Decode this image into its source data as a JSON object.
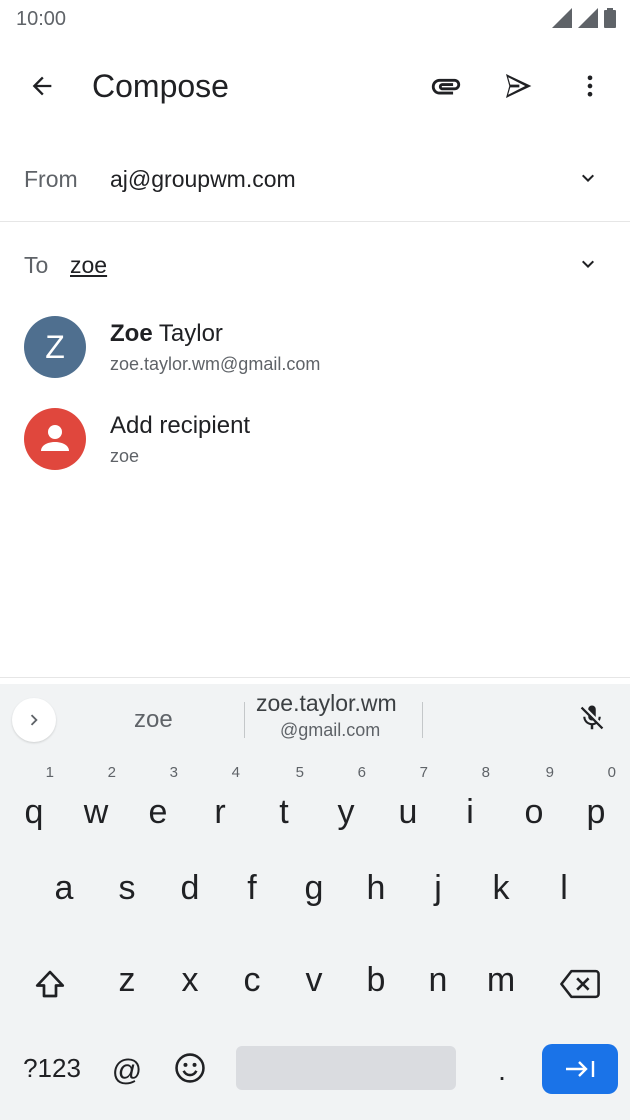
{
  "status_bar": {
    "time": "10:00"
  },
  "app_bar": {
    "title": "Compose"
  },
  "from": {
    "label": "From",
    "value": "aj@groupwm.com"
  },
  "to": {
    "label": "To",
    "value": "zoe"
  },
  "suggestions": [
    {
      "avatar_letter": "Z",
      "name_bold": "Zoe",
      "name_rest": " Taylor",
      "sub": "zoe.taylor.wm@gmail.com",
      "avatar_color": "#4f6f8f"
    },
    {
      "avatar_letter": "",
      "name_bold": "",
      "name_rest": "Add recipient",
      "sub": "zoe",
      "avatar_color": "#e0473d"
    }
  ],
  "keyboard_suggestions": {
    "word": "zoe",
    "email_line1": "zoe.taylor.wm",
    "email_line2": "@gmail.com"
  },
  "keyboard": {
    "row1": [
      {
        "k": "q",
        "n": "1"
      },
      {
        "k": "w",
        "n": "2"
      },
      {
        "k": "e",
        "n": "3"
      },
      {
        "k": "r",
        "n": "4"
      },
      {
        "k": "t",
        "n": "5"
      },
      {
        "k": "y",
        "n": "6"
      },
      {
        "k": "u",
        "n": "7"
      },
      {
        "k": "i",
        "n": "8"
      },
      {
        "k": "o",
        "n": "9"
      },
      {
        "k": "p",
        "n": "0"
      }
    ],
    "row2": [
      "a",
      "s",
      "d",
      "f",
      "g",
      "h",
      "j",
      "k",
      "l"
    ],
    "row3": [
      "z",
      "x",
      "c",
      "v",
      "b",
      "n",
      "m"
    ],
    "symbols_label": "?123",
    "at_label": "@",
    "period_label": "."
  },
  "colors": {
    "accent": "#1a73e8",
    "keyboard_bg": "#f1f3f4"
  }
}
